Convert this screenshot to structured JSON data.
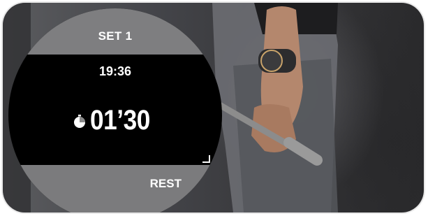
{
  "watch": {
    "set_label": "SET 1",
    "clock_time": "19:36",
    "timer_value": "01’30",
    "phase_label": "REST"
  },
  "icons": {
    "timer_icon": "stopwatch-icon",
    "next_indicator": "chevron-icon"
  },
  "colors": {
    "band": "#7e7e80",
    "face": "#000000",
    "text": "#ffffff"
  }
}
